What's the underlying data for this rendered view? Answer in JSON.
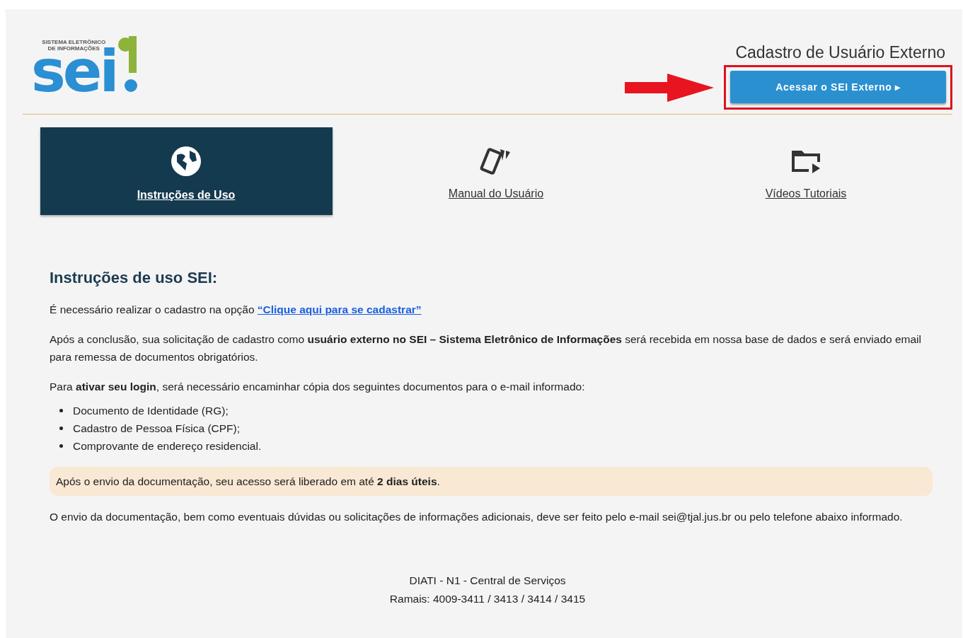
{
  "logo": {
    "tagline": [
      "SISTEMA ELETRÔNICO",
      "DE INFORMAÇÕES"
    ],
    "wordmark": "sei"
  },
  "header": {
    "title": "Cadastro de Usuário Externo",
    "button": "Acessar o SEI Externo",
    "button_caret": "▸"
  },
  "tabs": [
    {
      "label": "Instruções de Uso",
      "kind": "globe",
      "selected": true
    },
    {
      "label": "Manual do Usuário",
      "kind": "cards",
      "selected": false
    },
    {
      "label": "Vídeos Tutoriais",
      "kind": "video",
      "selected": false
    }
  ],
  "content": {
    "heading": "Instruções de uso SEI:",
    "intro": "É necessário realizar o cadastro na opção",
    "intro_link": "“Clique aqui para se cadastrar”",
    "paragraphs": [
      "Após a conclusão, sua solicitação de cadastro como **usuário externo no SEI – Sistema Eletrônico de Informações** será recebida em nossa base de dados e será enviado email para remessa de documentos obrigatórios.",
      "Para **ativar seu login**, será necessário encaminhar cópia dos seguintes documentos para o e-mail informado:"
    ],
    "documents": [
      "Documento de Identidade (RG);",
      "Cadastro de Pessoa Física (CPF);",
      "Comprovante de endereço residencial."
    ],
    "notice": "Após o envio da documentação, seu acesso será liberado em até **2 dias úteis**.",
    "closing": "O envio da documentação, bem como eventuais dúvidas ou solicitações de informações adicionais, deve ser feito pelo e-mail sei@tjal.jus.br ou pelo telefone abaixo informado."
  },
  "footer": [
    "DIATI - N1 - Central de Serviços",
    "Ramais: 4009-3411 / 3413 / 3414 / 3415"
  ]
}
